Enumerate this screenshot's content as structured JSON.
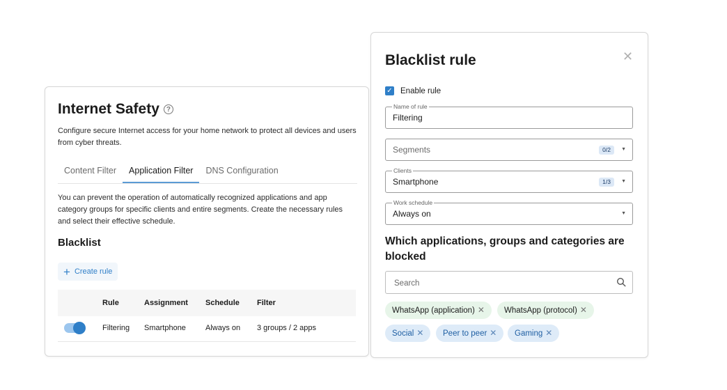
{
  "left_panel": {
    "title": "Internet Safety",
    "help_icon": "question-circle-icon",
    "description": "Configure secure Internet access for your home network to protect all devices and users from cyber threats.",
    "tabs": [
      {
        "label": "Content Filter",
        "active": false
      },
      {
        "label": "Application Filter",
        "active": true
      },
      {
        "label": "DNS Configuration",
        "active": false
      }
    ],
    "info_text": "You can prevent the operation of automatically recognized applications and app category groups for specific clients and entire segments. Create the necessary rules and select their effective schedule.",
    "blacklist_title": "Blacklist",
    "create_rule_label": "Create rule",
    "table": {
      "headers": [
        "Rule",
        "Assignment",
        "Schedule",
        "Filter"
      ],
      "rows": [
        {
          "enabled": true,
          "rule": "Filtering",
          "assignment": "Smartphone",
          "schedule": "Always on",
          "filter": "3 groups / 2 apps"
        }
      ]
    }
  },
  "right_panel": {
    "title": "Blacklist rule",
    "close_icon": "close-icon",
    "enable_rule": {
      "label": "Enable rule",
      "checked": true
    },
    "name_field": {
      "legend": "Name of rule",
      "value": "Filtering"
    },
    "segments_field": {
      "placeholder": "Segments",
      "badge": "0/2"
    },
    "clients_field": {
      "legend": "Clients",
      "value": "Smartphone",
      "badge": "1/3"
    },
    "schedule_field": {
      "legend": "Work schedule",
      "value": "Always on"
    },
    "blocked_title": "Which applications, groups and categories are blocked",
    "search": {
      "placeholder": "Search"
    },
    "chips": [
      {
        "label": "WhatsApp (application)",
        "color": "green"
      },
      {
        "label": "WhatsApp (protocol)",
        "color": "green"
      },
      {
        "label": "Social",
        "color": "blue"
      },
      {
        "label": "Peer to peer",
        "color": "blue"
      },
      {
        "label": "Gaming",
        "color": "blue"
      }
    ]
  },
  "colors": {
    "accent": "#2f7fc8",
    "chip_green": "#e7f5e9",
    "chip_blue": "#deebf8"
  }
}
